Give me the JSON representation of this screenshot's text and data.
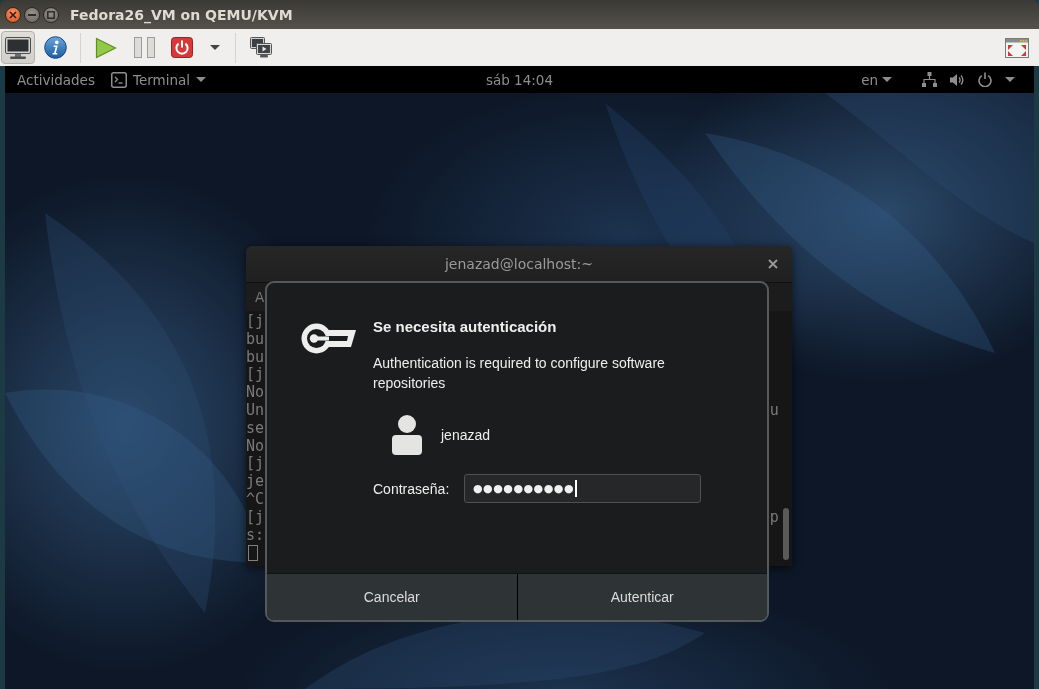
{
  "window": {
    "title": "Fedora26_VM on QEMU/KVM"
  },
  "toolbar": {
    "view_buttons": [
      {
        "selected": true
      },
      {
        "selected": false
      }
    ]
  },
  "top_bar": {
    "activities": "Actividades",
    "app_menu": "Terminal",
    "clock": "sáb 14:04",
    "input_source": "en"
  },
  "terminal": {
    "title": "jenazad@localhost:~",
    "menu": [
      "A"
    ],
    "lines": [
      {
        "left": "[j"
      },
      {
        "left": "bu"
      },
      {
        "left": "bu"
      },
      {
        "left": "[j"
      },
      {
        "left": "No"
      },
      {
        "left": "Un",
        "right": "u"
      },
      {
        "left": "se"
      },
      {
        "left": "No"
      },
      {
        "left": "[j"
      },
      {
        "left": "je"
      },
      {
        "left": "^C"
      },
      {
        "left": "[j",
        "right": "p"
      },
      {
        "left": "s:"
      }
    ]
  },
  "dialog": {
    "title": "Se necesita autenticación",
    "message": "Authentication is required to configure software repositories",
    "user": "jenazad",
    "password": {
      "label": "Contraseña:",
      "value": "●●●●●●●●●●"
    },
    "buttons": [
      "Cancelar",
      "Autenticar"
    ]
  }
}
